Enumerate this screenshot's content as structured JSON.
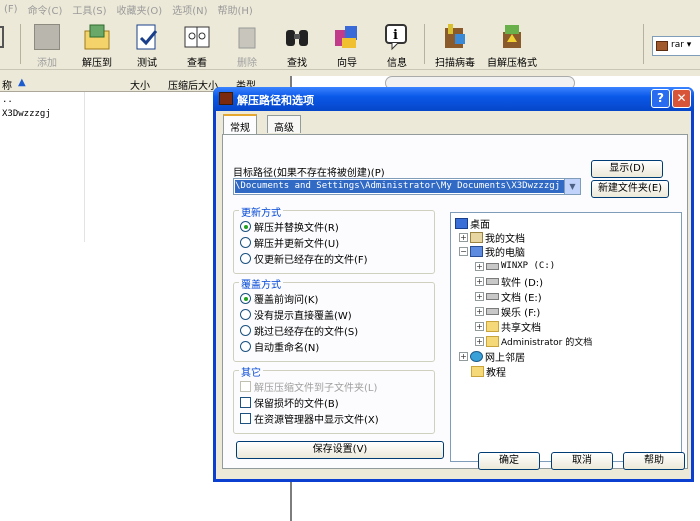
{
  "menu": [
    "(F)",
    "命令(C)",
    "工具(S)",
    "收藏夹(O)",
    "选项(N)",
    "帮助(H)"
  ],
  "toolbar": {
    "add": "添加",
    "extract": "解压到",
    "test": "测试",
    "view": "查看",
    "delete": "删除",
    "find": "查找",
    "wizard": "向导",
    "info": "信息",
    "scan": "扫描病毒",
    "sfx": "自解压格式",
    "archive_type": "rar"
  },
  "filelist": {
    "headers": {
      "name": "称",
      "up": "▲",
      "size": "大小",
      "packed": "压缩后大小",
      "type": "类型"
    },
    "rows": [
      "..",
      "X3Dwzzzgj"
    ]
  },
  "dialog": {
    "title": "解压路径和选项",
    "tabs": [
      "常规",
      "高级"
    ],
    "path_label": "目标路径(如果不存在将被创建)(P)",
    "path_value": "\\Documents and Settings\\Administrator\\My Documents\\X3Dwzzzgj",
    "show_button": "显示(D)",
    "new_folder_button": "新建文件夹(E)",
    "update": {
      "title": "更新方式",
      "options": [
        "解压并替换文件(R)",
        "解压并更新文件(U)",
        "仅更新已经存在的文件(F)"
      ],
      "selected": 0
    },
    "overwrite": {
      "title": "覆盖方式",
      "options": [
        "覆盖前询问(K)",
        "没有提示直接覆盖(W)",
        "跳过已经存在的文件(S)",
        "自动重命名(N)"
      ],
      "selected": 0
    },
    "misc": {
      "title": "其它",
      "options": [
        "解压压缩文件到子文件夹(L)",
        "保留损坏的文件(B)",
        "在资源管理器中显示文件(X)"
      ]
    },
    "save_button": "保存设置(V)",
    "tree": {
      "desktop": "桌面",
      "my_docs": "我的文档",
      "my_computer": "我的电脑",
      "drive_c": "WINXP (C:)",
      "drive_d": "软件 (D:)",
      "drive_e": "文档 (E:)",
      "drive_f": "娱乐 (F:)",
      "shared": "共享文档",
      "admin_docs": "Administrator 的文档",
      "network": "网上邻居",
      "tutorial": "教程"
    },
    "ok": "确定",
    "cancel": "取消",
    "help": "帮助"
  }
}
